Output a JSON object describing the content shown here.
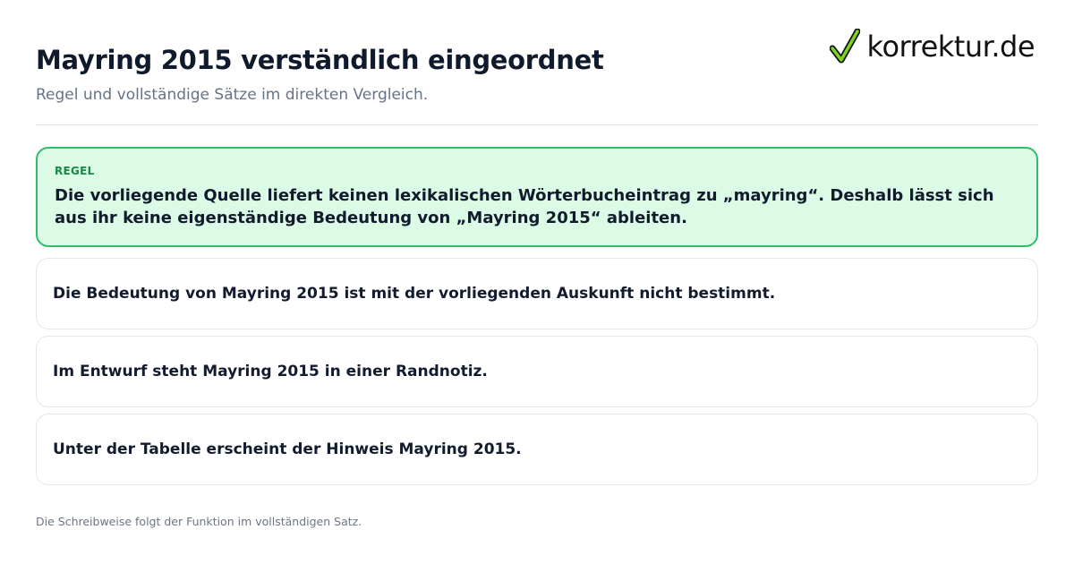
{
  "header": {
    "title": "Mayring 2015 verständlich eingeordnet",
    "subtitle": "Regel und vollständige Sätze im direkten Vergleich."
  },
  "logo": {
    "text": "korrektur.de",
    "icon": "checkmark-icon",
    "check_color": "#7ed321"
  },
  "rule": {
    "label": "REGEL",
    "text": "Die vorliegende Quelle liefert keinen lexikalischen Wörterbucheintrag zu „mayring“. Deshalb lässt sich aus ihr keine eigenständige Bedeutung von „Mayring 2015“ ableiten.",
    "border_color": "#2ebd6b",
    "background_color": "#dcfbe7",
    "label_color": "#168a45"
  },
  "examples": [
    "Die Bedeutung von Mayring 2015 ist mit der vorliegenden Auskunft nicht bestimmt.",
    "Im Entwurf steht Mayring 2015 in einer Randnotiz.",
    "Unter der Tabelle erscheint der Hinweis Mayring 2015."
  ],
  "footer": {
    "note": "Die Schreibweise folgt der Funktion im vollständigen Satz."
  }
}
